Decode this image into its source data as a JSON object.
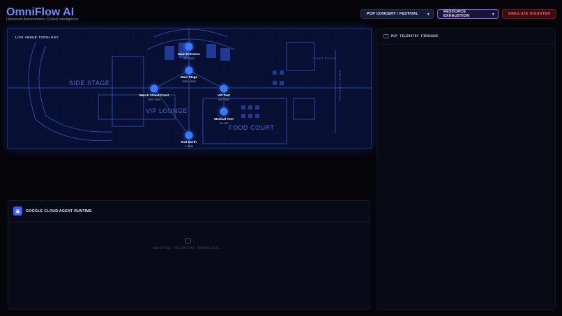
{
  "brand": {
    "title": "OmniFlow AI",
    "subtitle": "Universal Autonomous Crowd Intelligence"
  },
  "controls": {
    "scenario": "POP CONCERT / FESTIVAL",
    "mode": "RESOURCE EXHAUSTION",
    "simulate": "SIMULATE DISASTER"
  },
  "map": {
    "label": "LIVE VENUE TOPOLOGY",
    "areas": [
      "SIDE STAGE",
      "VIP LOUNGE",
      "FOOD COURT",
      "TICKET BOOTH",
      "ARTIST ENTRANCE"
    ],
    "nodes": [
      {
        "name": "Main Entrance",
        "capacity": "482 / 1000"
      },
      {
        "name": "Main Stage",
        "capacity": "1926 / 10000"
      },
      {
        "name": "Merch / Food Court",
        "capacity": "1392 / 3000"
      },
      {
        "name": "VIP Tent",
        "capacity": "409 / 1000"
      },
      {
        "name": "Medical Tent",
        "capacity": "34 / 200"
      },
      {
        "name": "Exit North",
        "capacity": "0 / 1000"
      }
    ]
  },
  "agent": {
    "title": "GOOGLE CLOUD AGENT RUNTIME",
    "status": "AWAITING TELEMETRY ANOMALIES..."
  },
  "telemetry": {
    "title": "MCP TELEMETRY FIREHOSE"
  },
  "colors": {
    "accent": "#3a78ff",
    "brand": "#6b8cff",
    "danger": "#ff5a64",
    "mode_border": "#8c5cf0"
  },
  "icons": {
    "agent": "robot-icon",
    "telemetry": "terminal-icon",
    "awaiting": "clock-icon"
  }
}
